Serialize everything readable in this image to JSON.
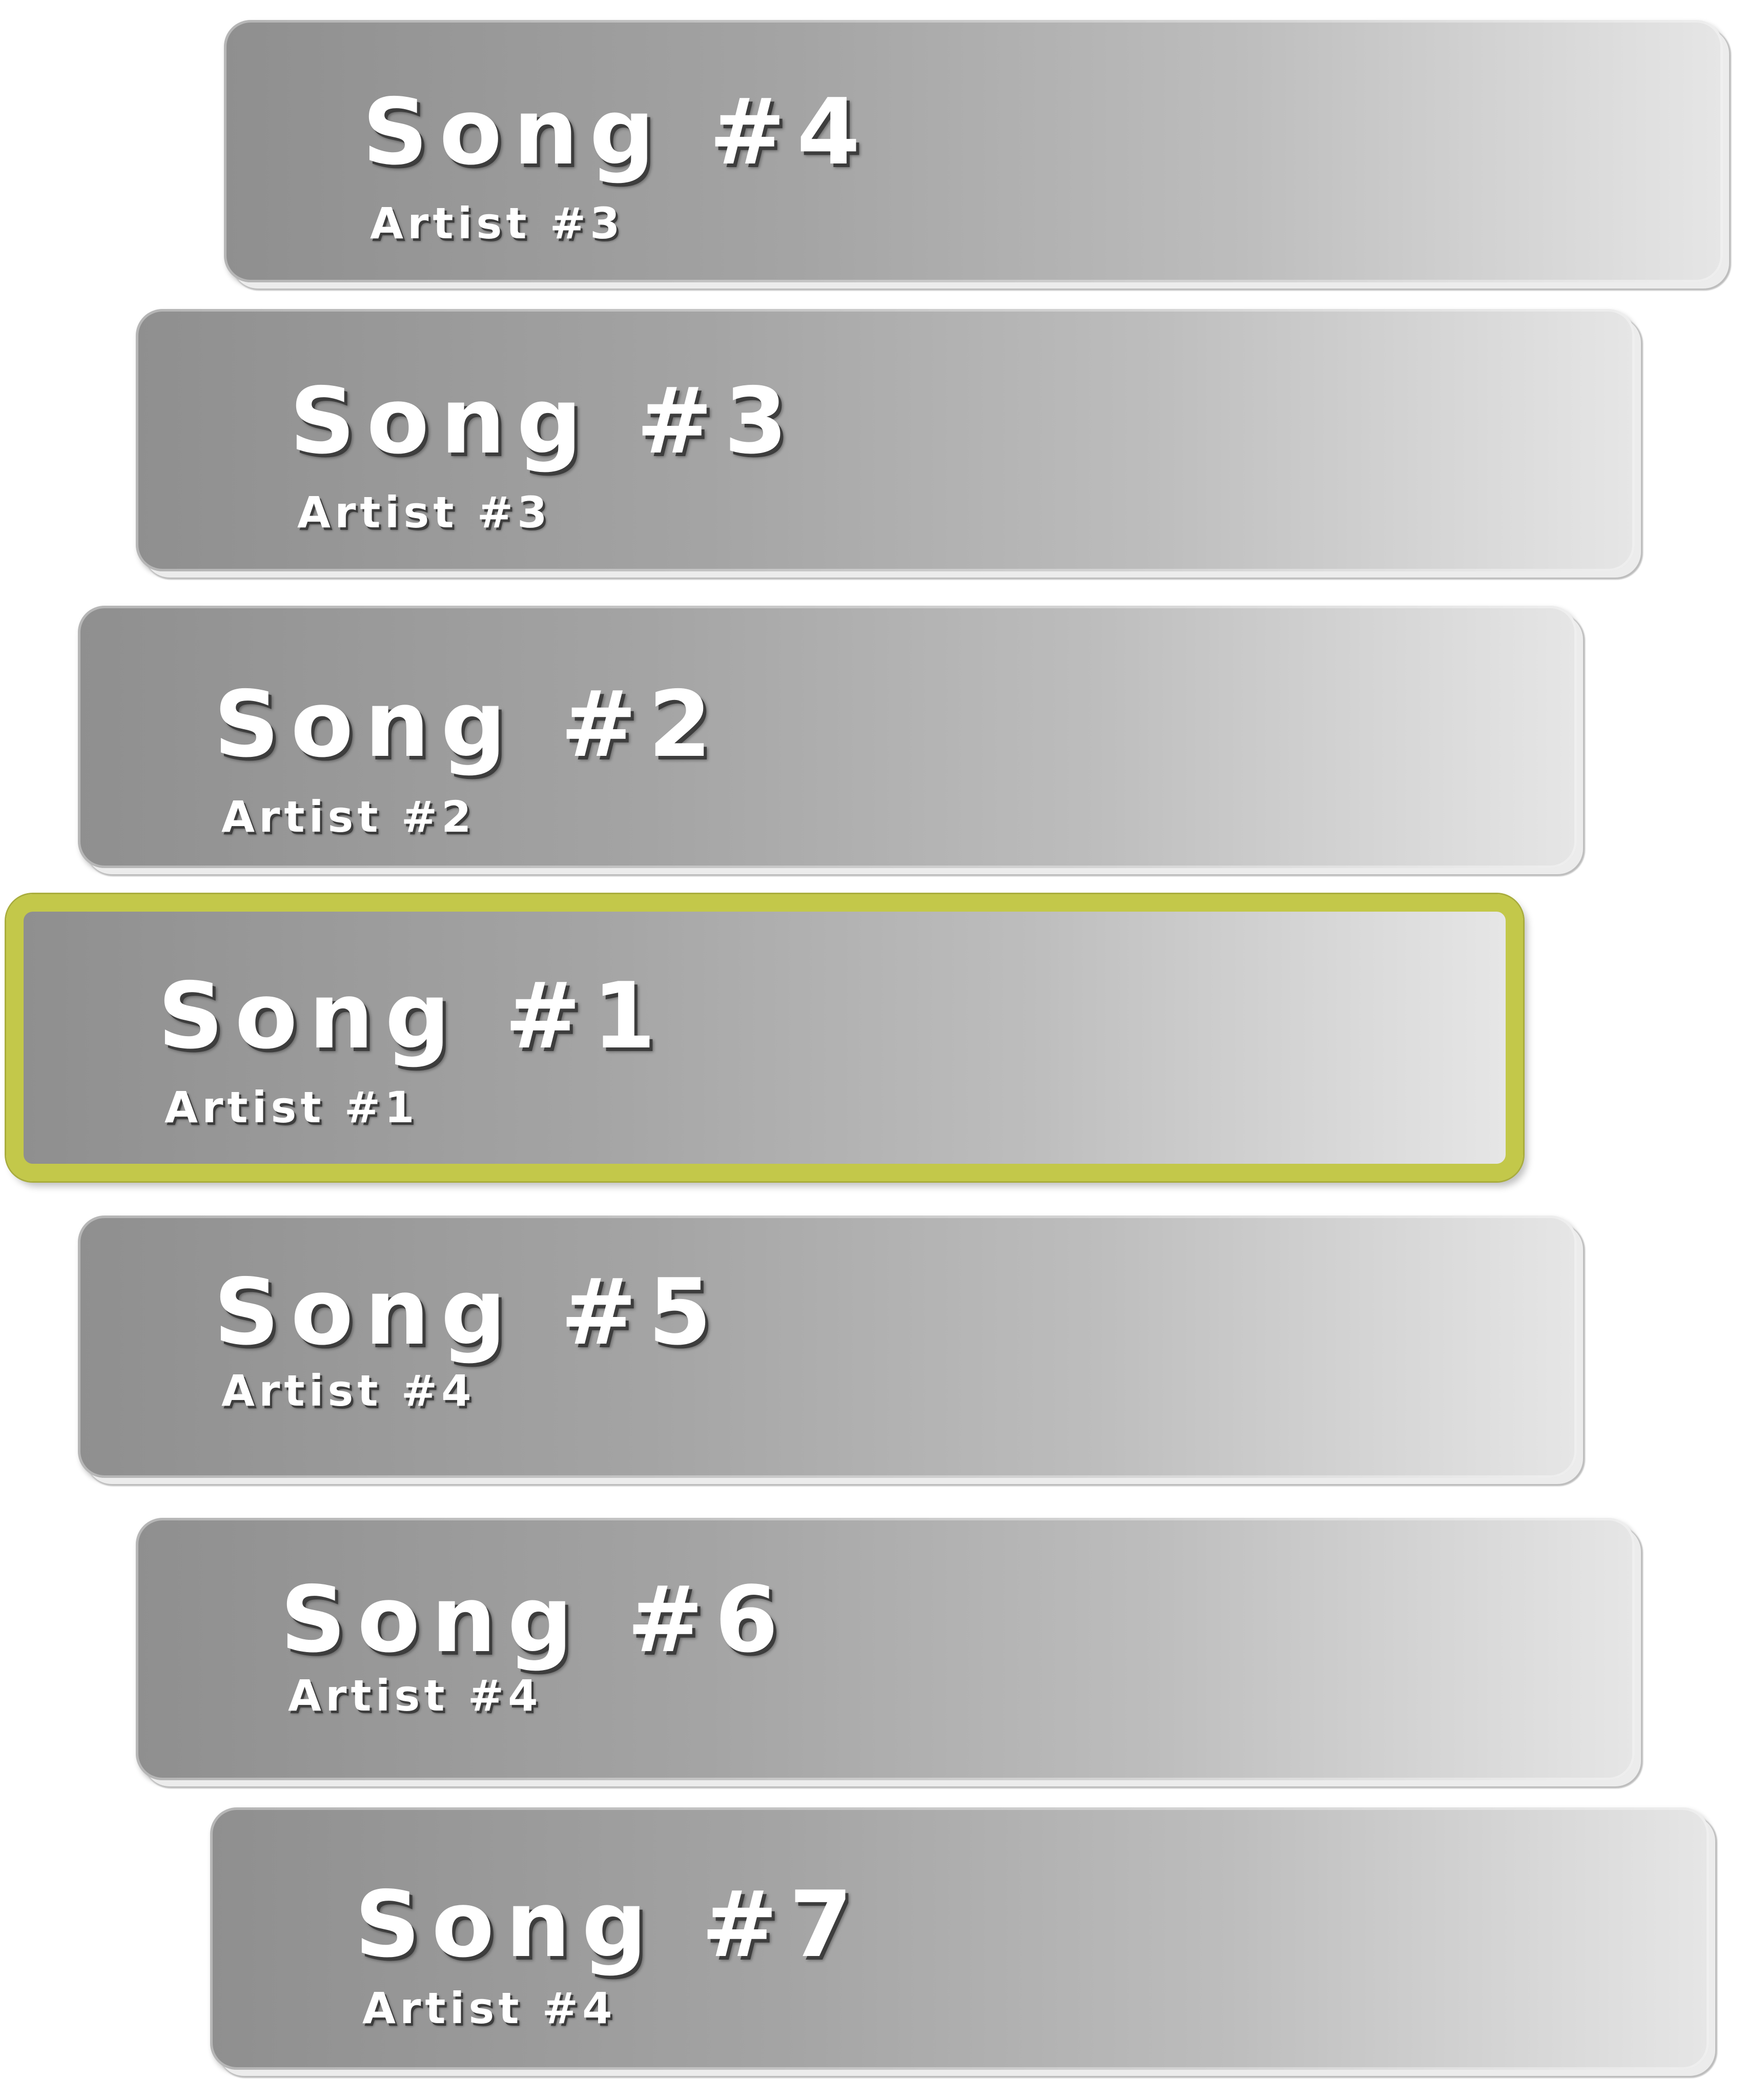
{
  "accent_color": "#c3c84a",
  "selected_index": 3,
  "songs": [
    {
      "title": "Song #4",
      "artist": "Artist #3"
    },
    {
      "title": "Song #3",
      "artist": "Artist #3"
    },
    {
      "title": "Song #2",
      "artist": "Artist #2"
    },
    {
      "title": "Song #1",
      "artist": "Artist #1"
    },
    {
      "title": "Song #5",
      "artist": "Artist #4"
    },
    {
      "title": "Song #6",
      "artist": "Artist #4"
    },
    {
      "title": "Song #7",
      "artist": "Artist #4"
    }
  ]
}
